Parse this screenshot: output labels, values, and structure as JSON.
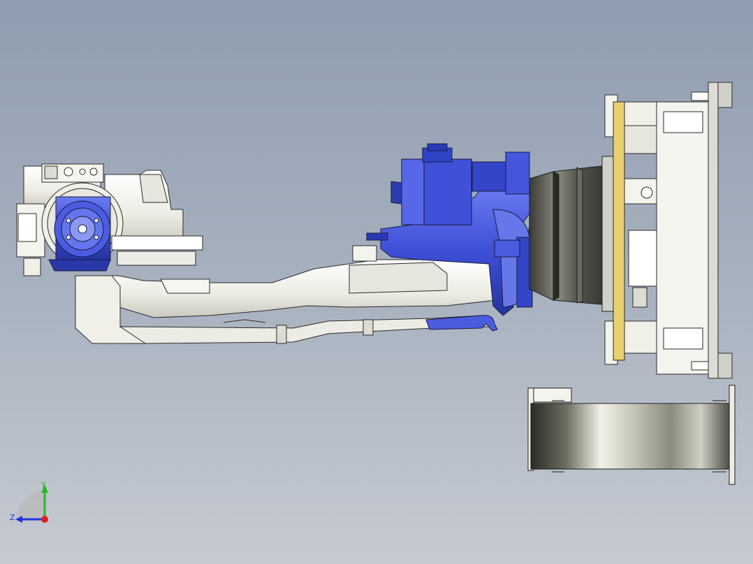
{
  "viewport": {
    "background_top": "#8f9db0",
    "background_bottom": "#c6cad2"
  },
  "model": {
    "part_colors": {
      "blue": "#3d4fd6",
      "blue_dark": "#1f2f9a",
      "blue_light": "#7f8ef0",
      "white": "#f4f4ee",
      "outline": "#2a2a2a",
      "dark_drum": "#4a4c44",
      "yellow": "#e8d070",
      "steel": "#cfd0c8"
    }
  },
  "triad": {
    "y_label": "Y",
    "z_label": "Z",
    "y_color": "#22bb22",
    "z_color": "#2233dd",
    "origin_color": "#e02020"
  }
}
